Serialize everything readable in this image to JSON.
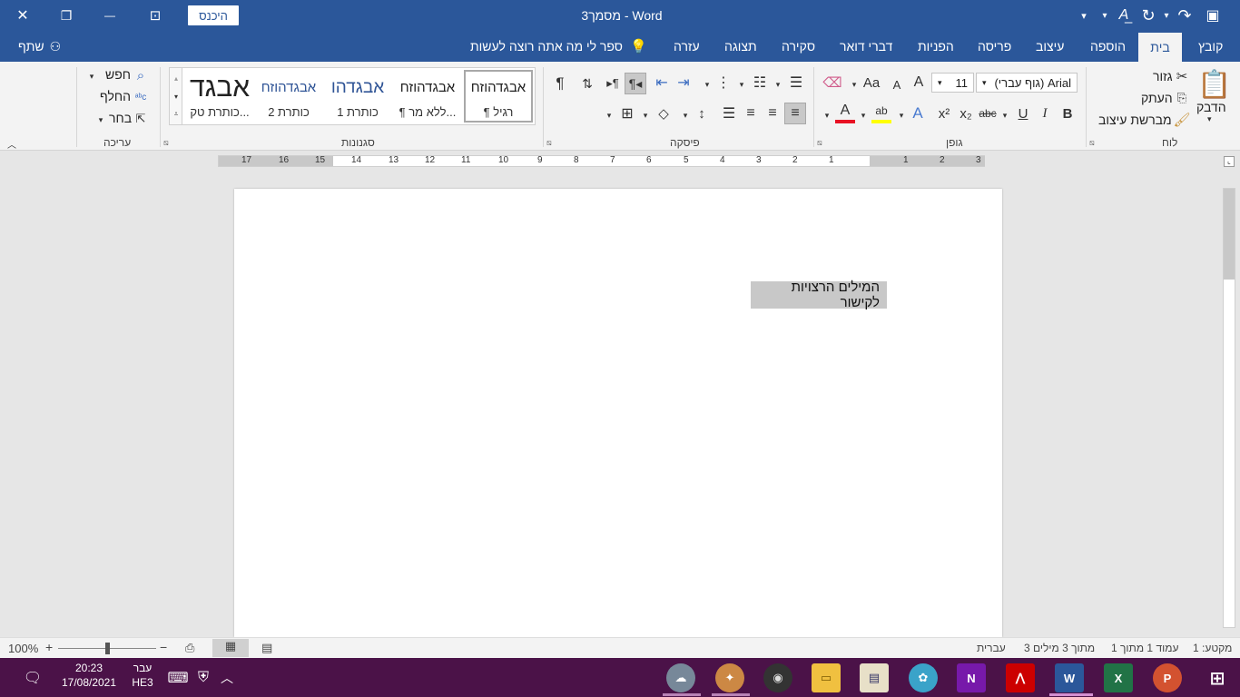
{
  "titlebar": {
    "title": "מסמך3  -  Word",
    "signin": "היכנס",
    "close_glyph": "✕",
    "restore_glyph": "❐",
    "minimize_glyph": "—",
    "ribbon_display_glyph": "⊡",
    "customize_glyph": "▾",
    "format_glyph": "A͟",
    "redo_glyph": "↷",
    "undo_glyph": "↶",
    "save_glyph": "▣"
  },
  "tabs": {
    "file": "קובץ",
    "home": "בית",
    "insert": "הוספה",
    "design": "עיצוב",
    "layout": "פריסה",
    "references": "הפניות",
    "mailings": "דברי דואר",
    "review": "סקירה",
    "view": "תצוגה",
    "help": "עזרה",
    "tell_me": "ספר לי מה אתה רוצה לעשות",
    "share": "שתף"
  },
  "clipboard": {
    "paste": "הדבק",
    "cut": "גזור",
    "copy": "העתק",
    "format_painter": "מברשת עיצוב",
    "label": "לוח"
  },
  "font": {
    "font_name": "Arial (גוף עברי)",
    "font_size": "11",
    "bold": "B",
    "italic": "I",
    "underline": "U",
    "strike": "abc",
    "subscript": "x₂",
    "superscript": "x²",
    "grow": "A",
    "shrink": "A",
    "case": "Aa",
    "label": "גופן"
  },
  "paragraph": {
    "pilcrow": "¶",
    "label": "פיסקה"
  },
  "styles": {
    "items": [
      {
        "preview": "אבגדהוזח",
        "name": "¶ רגיל"
      },
      {
        "preview": "אבגדהוזח",
        "name": "¶ ללא מר..."
      },
      {
        "preview": "אבגדהו",
        "name": "כותרת 1"
      },
      {
        "preview": "אבגדהוזח",
        "name": "כותרת 2"
      },
      {
        "preview": "אבגד",
        "name": "כותרת טק..."
      }
    ],
    "label": "סגנונות"
  },
  "editing": {
    "find": "חפש",
    "replace": "החלף",
    "select": "בחר",
    "label": "עריכה"
  },
  "ruler": {
    "numbers": [
      "3",
      "2",
      "1",
      "1",
      "2",
      "3",
      "4",
      "5",
      "6",
      "7",
      "8",
      "9",
      "10",
      "11",
      "12",
      "13",
      "14",
      "15",
      "16",
      "17"
    ]
  },
  "document": {
    "selected_text": "המילים הרצויות לקישור"
  },
  "status": {
    "section": "מקטע: 1",
    "page": "עמוד 1 מתוך 1",
    "words": "3 מתוך 3 מילים",
    "language": "עברית",
    "zoom": "100%",
    "zoom_level": 0.5
  },
  "taskbar": {
    "time": "20:23",
    "date": "17/08/2021",
    "lang_top": "עבר",
    "lang_bottom": "HE3"
  },
  "colors": {
    "word_blue": "#2b579a",
    "taskbar": "#4b1248",
    "selection": "#c8c8c8",
    "font_color_red": "#e81123",
    "highlight_yellow": "#ffff00"
  }
}
